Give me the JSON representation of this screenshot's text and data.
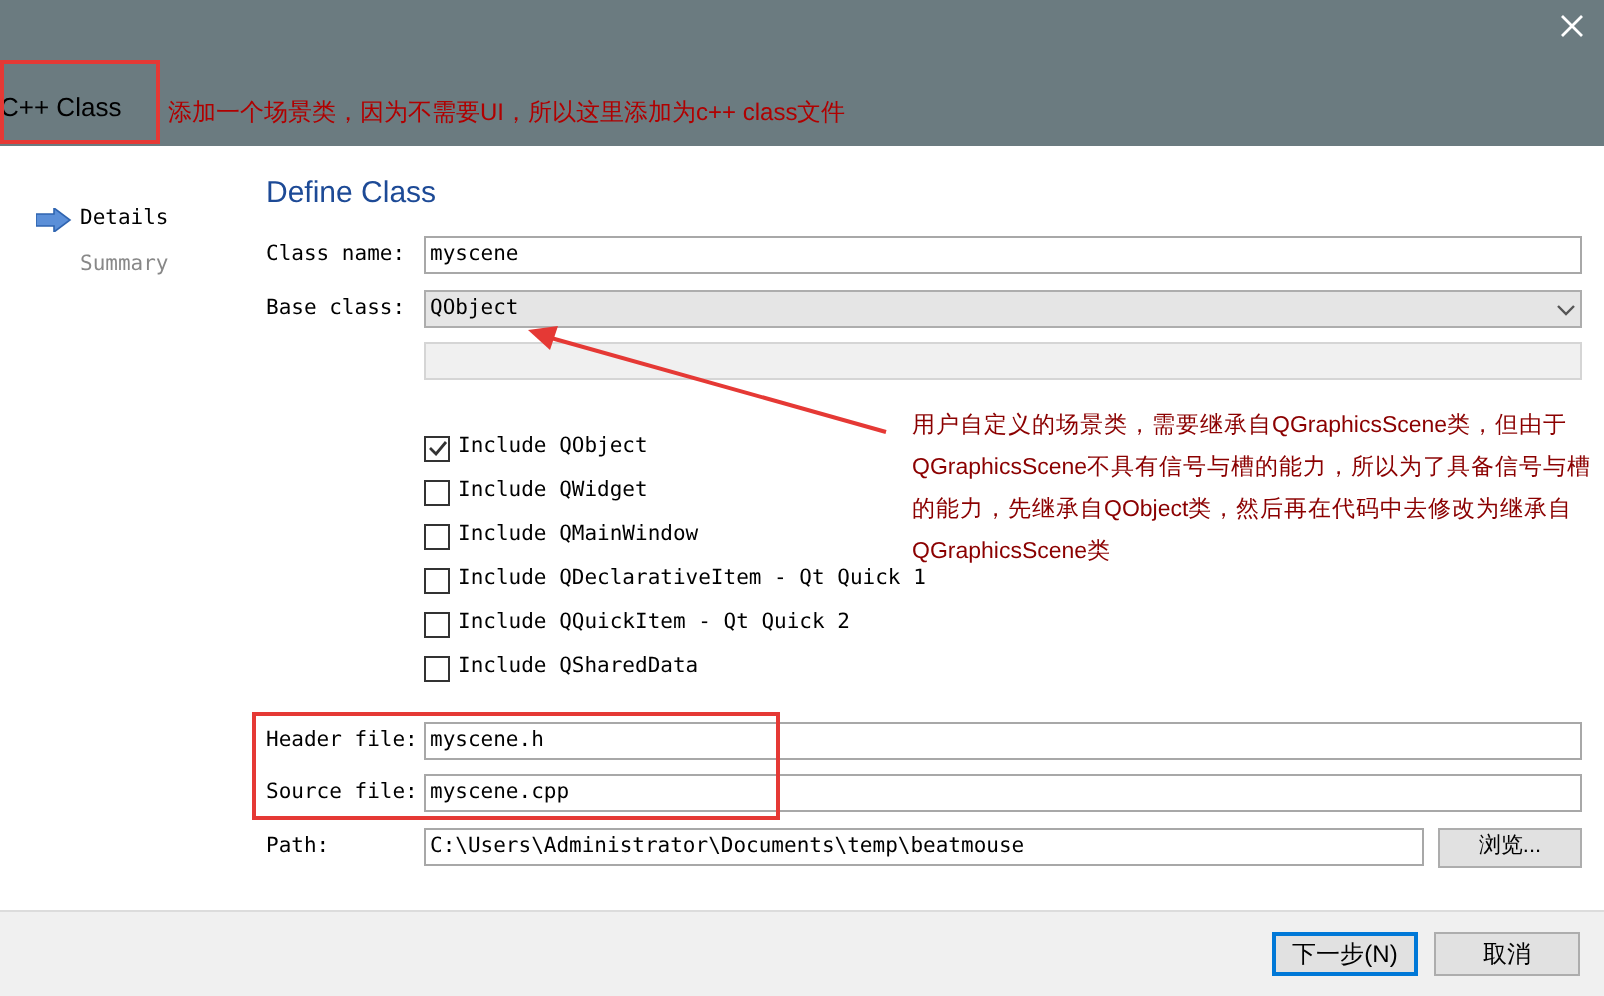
{
  "window": {
    "title": "C++ Class"
  },
  "annotations": {
    "title_note": "添加一个场景类，因为不需要UI，所以这里添加为c++ class文件",
    "base_class_note": "用户自定义的场景类，需要继承自QGraphicsScene类，但由于QGraphicsScene不具有信号与槽的能力，所以为了具备信号与槽的能力，先继承自QObject类，然后再在代码中去修改为继承自QGraphicsScene类"
  },
  "steps": [
    {
      "label": "Details",
      "selected": true
    },
    {
      "label": "Summary",
      "selected": false
    }
  ],
  "heading": "Define Class",
  "class_name": {
    "label": "Class name:",
    "value": "myscene"
  },
  "base_class": {
    "label": "Base class:",
    "value": "QObject"
  },
  "includes": [
    {
      "label": "Include QObject",
      "checked": true
    },
    {
      "label": "Include QWidget",
      "checked": false
    },
    {
      "label": "Include QMainWindow",
      "checked": false
    },
    {
      "label": "Include QDeclarativeItem - Qt Quick 1",
      "checked": false
    },
    {
      "label": "Include QQuickItem - Qt Quick 2",
      "checked": false
    },
    {
      "label": "Include QSharedData",
      "checked": false
    }
  ],
  "header_file": {
    "label": "Header file:",
    "value": "myscene.h"
  },
  "source_file": {
    "label": "Source file:",
    "value": "myscene.cpp"
  },
  "path": {
    "label": "Path:",
    "value": "C:\\Users\\Administrator\\Documents\\temp\\beatmouse",
    "browse": "浏览..."
  },
  "buttons": [
    {
      "label": "下一步(N)",
      "kind": "default"
    },
    {
      "label": "取消",
      "kind": "normal"
    }
  ]
}
